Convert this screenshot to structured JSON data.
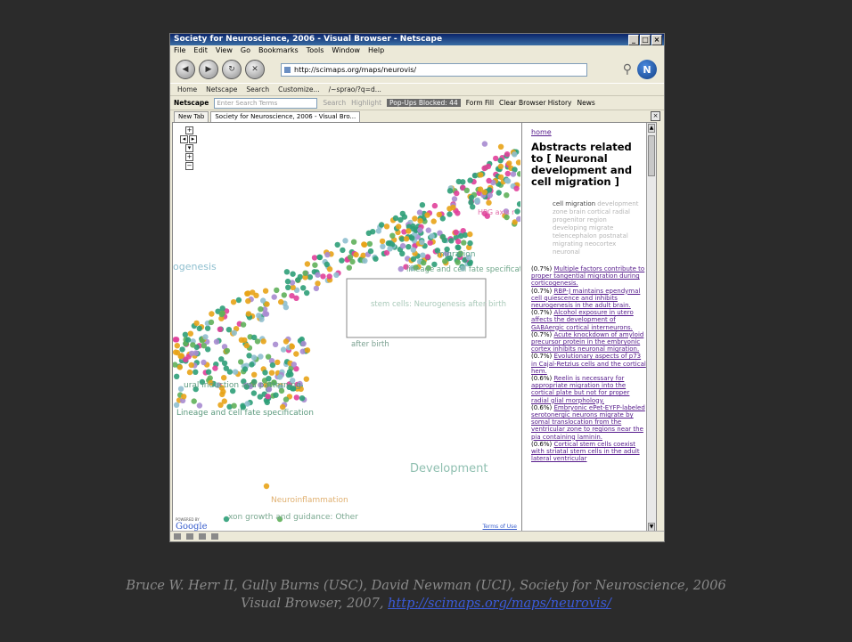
{
  "window": {
    "title": "Society for Neuroscience, 2006 - Visual Browser - Netscape",
    "menu": [
      "File",
      "Edit",
      "View",
      "Go",
      "Bookmarks",
      "Tools",
      "Window",
      "Help"
    ],
    "url": "http://scimaps.org/maps/neurovis/",
    "bookmarks": [
      "Home",
      "Netscape",
      "Search",
      "Customize...",
      "/~sprao/?q=d..."
    ],
    "netscape_label": "Netscape",
    "search_placeholder": "Enter Search Terms",
    "search_button": "Search",
    "highlight_button": "Highlight",
    "popups_label": "Pop-Ups Blocked: 44",
    "form_fill": "Form Fill",
    "clear_history": "Clear Browser History",
    "news": "News",
    "tabs": [
      "New Tab",
      "Society for Neuroscience, 2006 - Visual Bro..."
    ]
  },
  "map": {
    "labels": {
      "ogenesis": "ogenesis",
      "migration": "migration",
      "lineage_spec": "lineage and cell fate specification",
      "hpg": "HPG axis r",
      "stem_cells": "stem cells: Neurogenesis after birth",
      "after_birth": "after birth",
      "neural_induction": "ural induction and patterning",
      "lineage_spec2": "Lineage and cell fate specification",
      "development": "Development",
      "neuroinflammation": "Neuroinflammation",
      "axon": "xon growth and guidance: Other"
    },
    "google": "Google",
    "powered_by": "POWERED BY",
    "terms": "Terms of Use"
  },
  "sidebar": {
    "home": "home",
    "heading": "Abstracts related to [ Neuronal development and cell migration ]",
    "cloud_strong": "cell migration",
    "cloud_rest": "development zone brain cortical radial progenitor region developing migrate telencephalon postnatal migrating neocortex neuronal",
    "results": [
      {
        "pct": "(0.7%)",
        "title": "Multiple factors contribute to proper tangential migration during corticogenesis."
      },
      {
        "pct": "(0.7%)",
        "title": "RBP-J maintains ependymal cell quiescence and inhibits neurogenesis in the adult brain."
      },
      {
        "pct": "(0.7%)",
        "title": "Alcohol exposure in utero affects the development of GABAergic cortical interneurons."
      },
      {
        "pct": "(0.7%)",
        "title": "Acute knockdown of amyloid precursor protein in the embryonic cortex inhibits neuronal migration."
      },
      {
        "pct": "(0.7%)",
        "title": "Evolutionary aspects of p73 in Cajal-Retzius cells and the cortical hem."
      },
      {
        "pct": "(0.6%)",
        "title": "Reelin is necessary for appropriate migration into the cortical plate but not for proper radial glial morphology."
      },
      {
        "pct": "(0.6%)",
        "title": "Embryonic ePet-EYFP-labeled serotonergic neurons migrate by somal translocation from the ventricular zone to regions near the pia containing laminin."
      },
      {
        "pct": "(0.6%)",
        "title": "Cortical stem cells coexist with striatal stem cells in the adult lateral ventricular"
      }
    ]
  },
  "caption": {
    "line1": "Bruce W. Herr II, Gully Burns (USC), David Newman (UCI), Society for Neuroscience, 2006",
    "line2_prefix": "Visual Browser, 2007, ",
    "link": "http://scimaps.org/maps/neurovis/"
  },
  "colors": {
    "teal": "#2e9e78",
    "green": "#5fb05a",
    "orange": "#e8a317",
    "pink": "#e0409a",
    "lavender": "#a78bd0",
    "light_blue": "#8fbfcf",
    "label_gray": "#8f9f97"
  }
}
